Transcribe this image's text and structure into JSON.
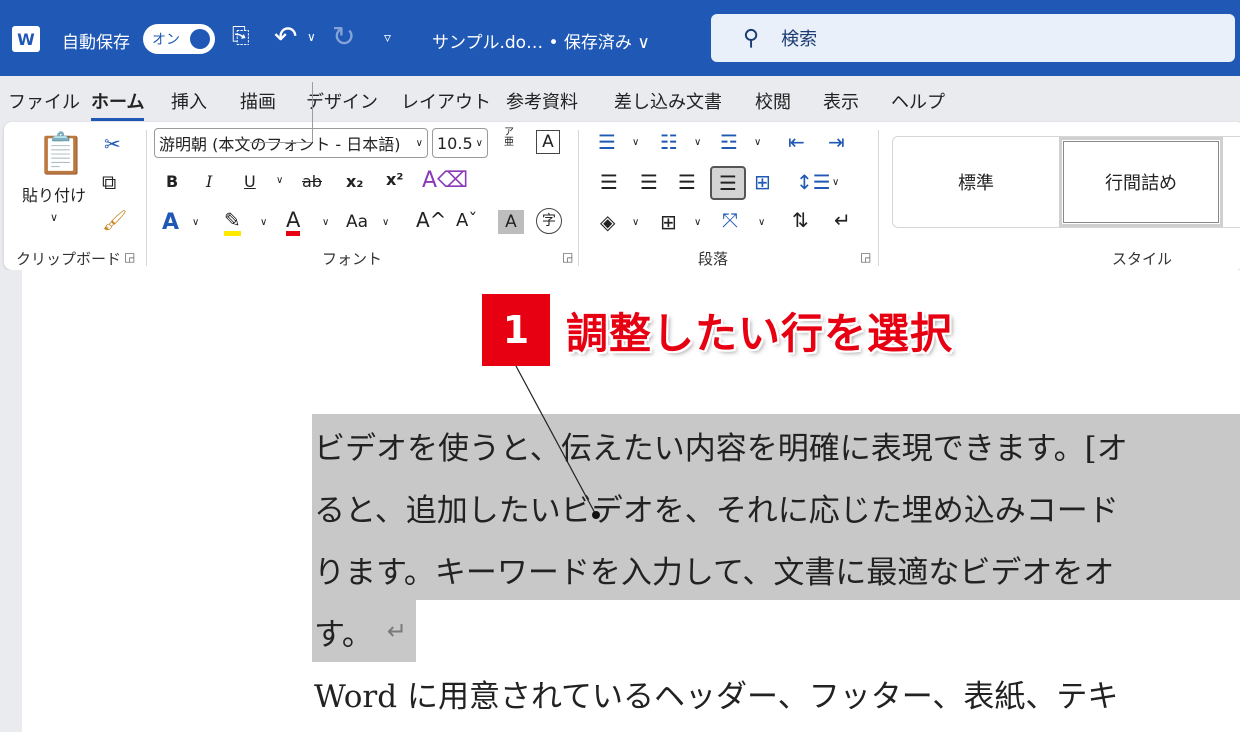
{
  "titlebar": {
    "app_icon": "word-logo-icon",
    "logo_text": "W",
    "autosave_label": "自動保存",
    "autosave_toggle": "オン",
    "doc_title": "サンプル.do… • 保存済み ∨",
    "search_placeholder": "検索"
  },
  "tabs": [
    "ファイル",
    "ホーム",
    "挿入",
    "描画",
    "デザイン",
    "レイアウト",
    "参考資料",
    "差し込み文書",
    "校閲",
    "表示",
    "ヘルプ"
  ],
  "active_tab": "ホーム",
  "ribbon": {
    "clipboard": {
      "paste_label": "貼り付け",
      "group_label": "クリップボード"
    },
    "font": {
      "font_name": "游明朝 (本文のフォント - 日本語)",
      "font_size": "10.5",
      "bold": "B",
      "italic": "I",
      "underline": "U",
      "strike": "ab",
      "subscript": "x₂",
      "superscript": "x²",
      "text_effect": "A",
      "highlight": "ab",
      "font_color": "A",
      "change_case": "Aa",
      "grow": "A^",
      "shrink": "Aˇ",
      "shading": "A",
      "enclose": "字",
      "phonetic_top": "ア",
      "phonetic_bottom": "亜",
      "char_border": "A",
      "group_label": "フォント"
    },
    "paragraph": {
      "group_label": "段落"
    },
    "styles": {
      "items": [
        "標準",
        "行間詰め"
      ],
      "group_label": "スタイル"
    }
  },
  "document": {
    "lines": [
      "ビデオを使うと、伝えたい内容を明確に表現できます。[オ",
      "ると、追加したいビデオを、それに応じた埋め込みコード",
      "ります。キーワードを入力して、文書に最適なビデオをオ",
      "す。",
      "Word に用意されているヘッダー、フッター、表紙、テキ"
    ],
    "paragraph_mark": "↵"
  },
  "annotation": {
    "number": "1",
    "text": "調整したい行を選択",
    "color": "#e60012"
  },
  "colors": {
    "titlebar": "#1f58b5",
    "selection": "#c8c8c8",
    "accent_red": "#e60012"
  }
}
